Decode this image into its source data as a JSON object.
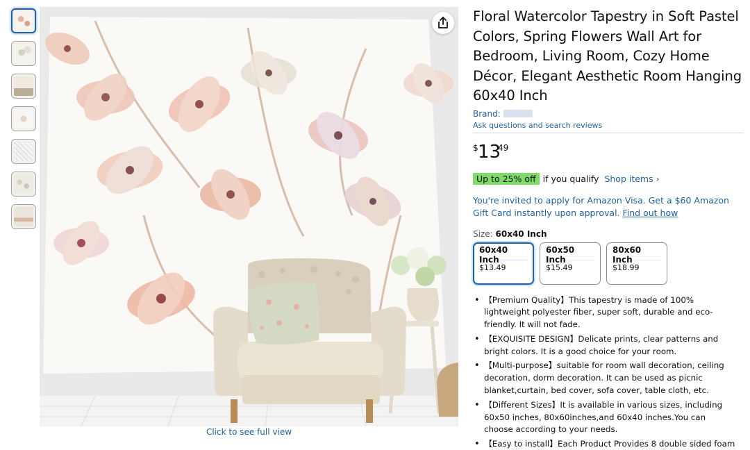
{
  "product": {
    "title": "Floral Watercolor Tapestry in Soft Pastel Colors, Spring Flowers Wall Art for Bedroom, Living Room, Cozy Home Décor, Elegant Aesthetic Room Hanging 60x40 Inch",
    "brand_label": "Brand:",
    "ask_link": "Ask questions and search reviews",
    "price": {
      "symbol": "$",
      "whole": "13",
      "fraction": "49"
    },
    "deal": {
      "badge": "Up to 25% off",
      "text": "if you qualify",
      "link": "Shop items ›"
    },
    "visa": {
      "text": "You're invited to apply for Amazon Visa. Get a $60 Amazon Gift Card instantly upon approval.",
      "link": "Find out how"
    },
    "size": {
      "label": "Size:",
      "selected": "60x40 Inch",
      "options": [
        {
          "name": "60x40 Inch",
          "price": "$13.49"
        },
        {
          "name": "60x50 Inch",
          "price": "$15.49"
        },
        {
          "name": "80x60 Inch",
          "price": "$18.99"
        }
      ]
    },
    "bullets": [
      "【Premium Quality】This tapestry is made of 100% lightweight polyester fiber, super soft, durable and eco-friendly. It will not fade.",
      "【EXQUISITE DESIGN】Delicate prints, clear patterns and bright colors. It is a good choice for your room.",
      "【Multi-purpose】suitable for room wall decoration, ceiling decoration, dorm decoration. It can be used as picnic blanket,curtain, bed cover, sofa cover, table cloth, etc.",
      "【Different Sizes】It is available in various sizes, including 60x50 inches, 80x60inches,and 60x40 inches.You can choose according to your needs.",
      "【Easy to install】Each Product Provides 8 double sided foam"
    ]
  },
  "gallery": {
    "thumbnail_count": 7,
    "selected_index": 0,
    "click_full_label": "Click to see full view",
    "share_icon": "share-icon"
  },
  "colors": {
    "link": "#2162a1",
    "deal_badge": "#7fda69",
    "text": "#0F1111"
  }
}
